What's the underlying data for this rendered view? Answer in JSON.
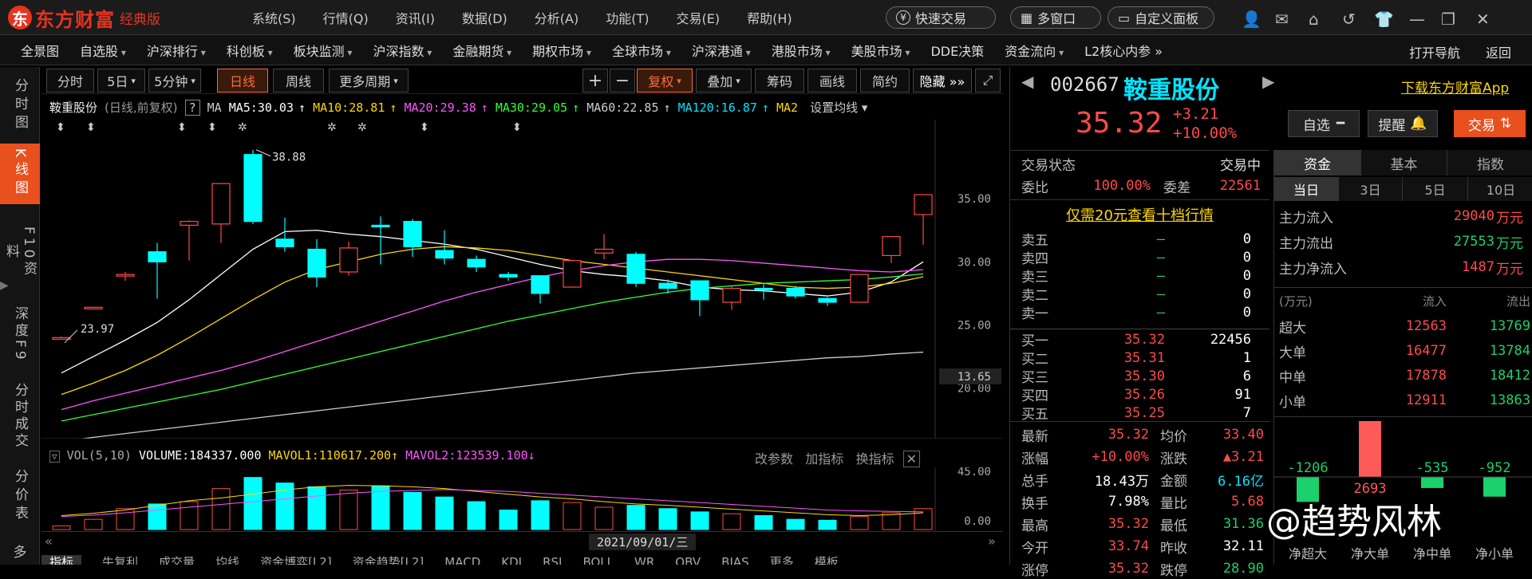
{
  "app": {
    "logo_mark": "东",
    "name": "东方财富",
    "edition": "经典版"
  },
  "top_menu": [
    "系统(S)",
    "行情(Q)",
    "资讯(I)",
    "数据(D)",
    "分析(A)",
    "功能(T)",
    "交易(E)",
    "帮助(H)"
  ],
  "top_buttons": {
    "quick_trade": "快速交易",
    "multi_window": "多窗口",
    "custom_panel": "自定义面板"
  },
  "nav": [
    {
      "label": "全景图",
      "dd": false
    },
    {
      "label": "自选股",
      "dd": true
    },
    {
      "label": "沪深排行",
      "dd": true
    },
    {
      "label": "科创板",
      "dd": true
    },
    {
      "label": "板块监测",
      "dd": true
    },
    {
      "label": "沪深指数",
      "dd": true
    },
    {
      "label": "金融期货",
      "dd": true
    },
    {
      "label": "期权市场",
      "dd": true
    },
    {
      "label": "全球市场",
      "dd": true
    },
    {
      "label": "沪深港通",
      "dd": true
    },
    {
      "label": "港股市场",
      "dd": true
    },
    {
      "label": "美股市场",
      "dd": true
    },
    {
      "label": "DDE决策",
      "dd": false
    },
    {
      "label": "资金流向",
      "dd": true
    },
    {
      "label": "L2核心内参 »",
      "dd": false
    }
  ],
  "nav_right": {
    "open_nav": "打开导航",
    "back": "返回"
  },
  "rail": [
    "分时图",
    "K线图",
    "F10资料",
    "深度F9",
    "分时成交",
    "分价表",
    "多"
  ],
  "chart_toolbar": {
    "periods": [
      "分时",
      "5日",
      "5分钟",
      "日线",
      "周线",
      "更多周期"
    ],
    "active": "日线",
    "tools": [
      "复权",
      "叠加",
      "筹码",
      "画线",
      "简约",
      "隐藏 »»"
    ]
  },
  "ma_header": {
    "name": "鞍重股份",
    "mode": "(日线,前复权)",
    "help": "?",
    "ma": "MA",
    "items": [
      {
        "t": "MA5:30.03",
        "c": "#ffffff"
      },
      {
        "t": "MA10:28.81",
        "c": "#ffd700"
      },
      {
        "t": "MA20:29.38",
        "c": "#ff55ff"
      },
      {
        "t": "MA30:29.05",
        "c": "#33ff33"
      },
      {
        "t": "MA60:22.85",
        "c": "#cccccc"
      },
      {
        "t": "MA120:16.87",
        "c": "#00e5ff"
      },
      {
        "t": "MA2",
        "c": "#ffd700"
      }
    ],
    "setting": "设置均线"
  },
  "chart_data": {
    "type": "candlestick",
    "ylim": [
      16,
      40
    ],
    "yticks": [
      "35.00",
      "30.00",
      "25.00",
      "20.00"
    ],
    "current_marker": "13.65",
    "high_label": "38.88",
    "low_label": "23.97",
    "candles": [
      {
        "o": 23.97,
        "c": 24.0,
        "h": 24.1,
        "l": 23.97
      },
      {
        "o": 26.3,
        "c": 26.4,
        "h": 26.4,
        "l": 26.2
      },
      {
        "o": 28.9,
        "c": 29.0,
        "h": 29.2,
        "l": 28.5
      },
      {
        "o": 30.8,
        "c": 30.0,
        "h": 31.5,
        "l": 27.1
      },
      {
        "o": 32.9,
        "c": 33.2,
        "h": 33.3,
        "l": 30.1
      },
      {
        "o": 33.0,
        "c": 36.2,
        "h": 36.2,
        "l": 31.5
      },
      {
        "o": 38.5,
        "c": 33.2,
        "h": 38.88,
        "l": 33.0
      },
      {
        "o": 31.8,
        "c": 31.2,
        "h": 33.5,
        "l": 30.8
      },
      {
        "o": 31.0,
        "c": 28.8,
        "h": 31.8,
        "l": 28.0
      },
      {
        "o": 29.2,
        "c": 31.1,
        "h": 31.6,
        "l": 28.9
      },
      {
        "o": 32.9,
        "c": 32.8,
        "h": 33.6,
        "l": 29.8
      },
      {
        "o": 33.2,
        "c": 31.2,
        "h": 33.4,
        "l": 30.4
      },
      {
        "o": 30.9,
        "c": 30.3,
        "h": 32.5,
        "l": 29.8
      },
      {
        "o": 30.2,
        "c": 29.6,
        "h": 30.5,
        "l": 29.2
      },
      {
        "o": 29.0,
        "c": 28.8,
        "h": 29.2,
        "l": 28.5
      },
      {
        "o": 28.9,
        "c": 27.5,
        "h": 28.9,
        "l": 26.7
      },
      {
        "o": 28.0,
        "c": 30.1,
        "h": 30.1,
        "l": 28.0
      },
      {
        "o": 30.7,
        "c": 31.0,
        "h": 32.2,
        "l": 30.2
      },
      {
        "o": 30.6,
        "c": 28.3,
        "h": 30.8,
        "l": 28.0
      },
      {
        "o": 28.3,
        "c": 27.9,
        "h": 28.6,
        "l": 27.5
      },
      {
        "o": 28.5,
        "c": 27.0,
        "h": 28.5,
        "l": 25.7
      },
      {
        "o": 26.8,
        "c": 27.9,
        "h": 28.1,
        "l": 26.2
      },
      {
        "o": 27.9,
        "c": 27.8,
        "h": 28.3,
        "l": 27.0
      },
      {
        "o": 27.9,
        "c": 27.3,
        "h": 28.1,
        "l": 27.1
      },
      {
        "o": 27.1,
        "c": 26.8,
        "h": 27.2,
        "l": 26.5
      },
      {
        "o": 26.8,
        "c": 29.0,
        "h": 29.0,
        "l": 26.8
      },
      {
        "o": 30.5,
        "c": 32.0,
        "h": 32.0,
        "l": 29.9
      },
      {
        "o": 33.74,
        "c": 35.32,
        "h": 35.32,
        "l": 31.36
      }
    ],
    "ma": [
      {
        "name": "MA5",
        "color": "#ffffff",
        "values": [
          21.2,
          22.5,
          23.8,
          25.2,
          27.0,
          29.0,
          31.0,
          32.4,
          32.5,
          32.2,
          32.0,
          31.7,
          31.4,
          31.0,
          30.4,
          29.8,
          29.3,
          29.0,
          28.8,
          28.5,
          28.0,
          27.8,
          27.7,
          27.5,
          27.3,
          27.6,
          28.4,
          30.0
        ]
      },
      {
        "name": "MA10",
        "color": "#ffd700",
        "values": [
          19.5,
          20.4,
          21.4,
          22.6,
          24.0,
          25.5,
          27.0,
          28.4,
          29.4,
          30.0,
          30.6,
          31.0,
          31.2,
          31.1,
          30.9,
          30.5,
          30.1,
          29.8,
          29.5,
          29.2,
          28.9,
          28.6,
          28.3,
          28.0,
          27.9,
          28.0,
          28.3,
          28.81
        ]
      },
      {
        "name": "MA20",
        "color": "#ff55ff",
        "values": [
          18.3,
          19.0,
          19.6,
          20.2,
          20.8,
          21.4,
          22.1,
          22.9,
          23.7,
          24.5,
          25.3,
          26.1,
          26.9,
          27.6,
          28.2,
          28.8,
          29.3,
          29.7,
          30.0,
          30.2,
          30.2,
          30.1,
          29.9,
          29.7,
          29.5,
          29.3,
          29.2,
          29.38
        ]
      },
      {
        "name": "MA30",
        "color": "#33ff33",
        "values": [
          17.4,
          17.9,
          18.4,
          18.9,
          19.4,
          19.9,
          20.5,
          21.1,
          21.7,
          22.3,
          22.9,
          23.5,
          24.1,
          24.7,
          25.3,
          25.8,
          26.3,
          26.8,
          27.2,
          27.6,
          27.9,
          28.1,
          28.3,
          28.4,
          28.5,
          28.6,
          28.8,
          29.05
        ]
      },
      {
        "name": "MA60",
        "color": "#cccccc",
        "values": [
          15.8,
          16.1,
          16.4,
          16.7,
          17.0,
          17.3,
          17.6,
          17.9,
          18.2,
          18.5,
          18.8,
          19.1,
          19.4,
          19.7,
          20.0,
          20.3,
          20.6,
          20.9,
          21.2,
          21.4,
          21.6,
          21.8,
          22.0,
          22.2,
          22.4,
          22.5,
          22.7,
          22.85
        ]
      }
    ],
    "volume": {
      "title": "VOL(5,10)",
      "volume_label": "VOLUME:184337.000",
      "mavol1": "MAVOL1:110617.200",
      "mavol2": "MAVOL2:123539.100",
      "yticks": [
        "45.00",
        "0.00"
      ],
      "ylim": [
        0,
        120000
      ],
      "values": [
        8000,
        22000,
        45000,
        55000,
        60000,
        88000,
        112000,
        100000,
        92000,
        85000,
        94000,
        80000,
        70000,
        60000,
        42000,
        62000,
        58000,
        48000,
        52000,
        45000,
        38000,
        34000,
        30000,
        22000,
        20000,
        28000,
        36000,
        45000
      ],
      "up": [
        true,
        true,
        true,
        false,
        true,
        true,
        false,
        false,
        false,
        true,
        false,
        false,
        false,
        false,
        false,
        false,
        true,
        true,
        false,
        false,
        false,
        true,
        false,
        false,
        false,
        true,
        true,
        true
      ]
    },
    "date": "2021/09/01/三"
  },
  "vol_tools": [
    "改参数",
    "加指标",
    "换指标"
  ],
  "bottom_tabs": [
    "指标",
    "牛复利",
    "成交量",
    "均线",
    "资金博弈[L2]",
    "资金趋势[L2]",
    "MACD",
    "KDJ",
    "RSI",
    "BOLL",
    "WR",
    "OBV",
    "BIAS",
    "更多",
    "模板"
  ],
  "quote": {
    "code": "002667",
    "name": "鞍重股份",
    "download": "下载东方财富App",
    "price": "35.32",
    "change": "+3.21",
    "pct": "+10.00%",
    "btn_watch": "自选",
    "btn_alert": "提醒",
    "btn_trade": "交易",
    "status_label": "交易状态",
    "status": "交易中",
    "wb_label": "委比",
    "wb": "100.00%",
    "wc_label": "委差",
    "wc": "22561",
    "l2_notice": "仅需20元查看十档行情",
    "sells": [
      {
        "l": "卖五",
        "p": "—",
        "v": "0"
      },
      {
        "l": "卖四",
        "p": "—",
        "v": "0"
      },
      {
        "l": "卖三",
        "p": "—",
        "v": "0"
      },
      {
        "l": "卖二",
        "p": "—",
        "v": "0"
      },
      {
        "l": "卖一",
        "p": "—",
        "v": "0"
      }
    ],
    "buys": [
      {
        "l": "买一",
        "p": "35.32",
        "v": "22456"
      },
      {
        "l": "买二",
        "p": "35.31",
        "v": "1"
      },
      {
        "l": "买三",
        "p": "35.30",
        "v": "6"
      },
      {
        "l": "买四",
        "p": "35.26",
        "v": "91"
      },
      {
        "l": "买五",
        "p": "35.25",
        "v": "7"
      }
    ],
    "stats": [
      {
        "l1": "最新",
        "v1": "35.32",
        "c1": "red",
        "l2": "均价",
        "v2": "33.40",
        "c2": "red"
      },
      {
        "l1": "涨幅",
        "v1": "+10.00%",
        "c1": "red",
        "l2": "涨跌",
        "v2": "▲3.21",
        "c2": "red"
      },
      {
        "l1": "总手",
        "v1": "18.43万",
        "c1": "white",
        "l2": "金额",
        "v2": "6.16亿",
        "c2": "cyan"
      },
      {
        "l1": "换手",
        "v1": "7.98%",
        "c1": "white",
        "l2": "量比",
        "v2": "5.68",
        "c2": "red"
      },
      {
        "l1": "最高",
        "v1": "35.32",
        "c1": "red",
        "l2": "最低",
        "v2": "31.36",
        "c2": "green"
      },
      {
        "l1": "今开",
        "v1": "33.74",
        "c1": "red",
        "l2": "昨收",
        "v2": "32.11",
        "c2": "white"
      },
      {
        "l1": "涨停",
        "v1": "35.32",
        "c1": "red",
        "l2": "跌停",
        "v2": "28.90",
        "c2": "green"
      }
    ]
  },
  "fund": {
    "tabs": [
      "资金",
      "基本",
      "指数"
    ],
    "periods": [
      "当日",
      "3日",
      "5日",
      "10日"
    ],
    "main": [
      {
        "l": "主力流入",
        "v": "29040",
        "u": "万元",
        "c": "red"
      },
      {
        "l": "主力流出",
        "v": "27553",
        "u": "万元",
        "c": "green"
      },
      {
        "l": "主力净流入",
        "v": "1487",
        "u": "万元",
        "c": "red"
      }
    ],
    "table_header": {
      "unit": "(万元)",
      "in": "流入",
      "out": "流出"
    },
    "table": [
      {
        "l": "超大",
        "in": "12563",
        "out": "13769"
      },
      {
        "l": "大单",
        "in": "16477",
        "out": "13784"
      },
      {
        "l": "中单",
        "in": "17878",
        "out": "18412"
      },
      {
        "l": "小单",
        "in": "12911",
        "out": "13863"
      }
    ],
    "net_bars": [
      {
        "label": "净超大",
        "value": -1206
      },
      {
        "label": "净大单",
        "value": 2693
      },
      {
        "label": "净中单",
        "value": -535
      },
      {
        "label": "净小单",
        "value": -952
      }
    ],
    "net_values": [
      "-1206",
      "2693",
      "-535",
      "-952"
    ],
    "watermark": "@趋势风林"
  }
}
